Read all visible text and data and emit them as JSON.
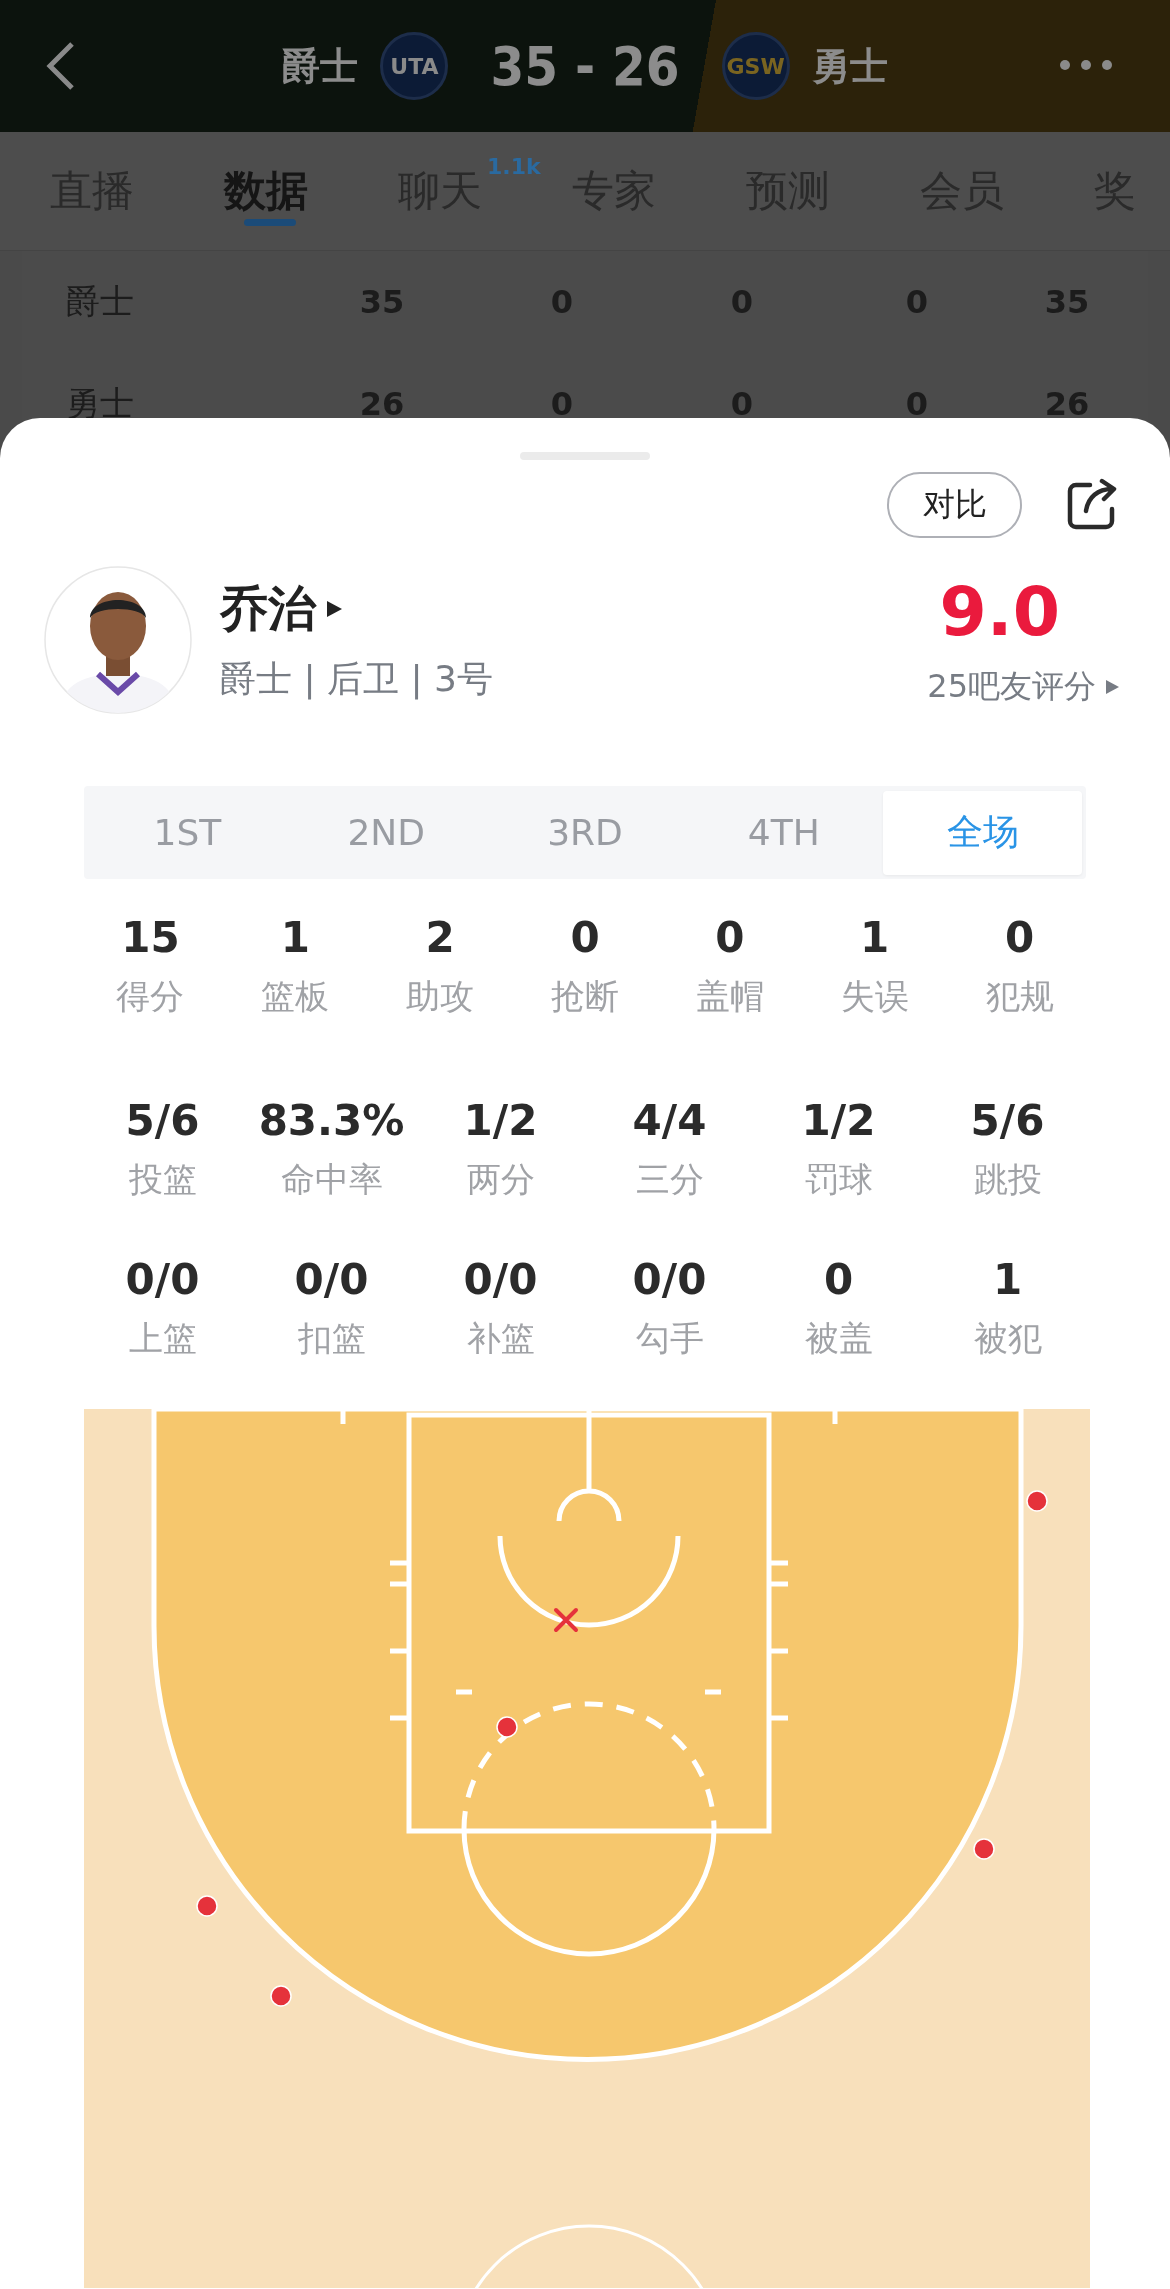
{
  "header": {
    "home": {
      "name": "爵士",
      "logo": "UTA"
    },
    "score": "35 - 26",
    "away": {
      "name": "勇士",
      "logo": "GSW"
    }
  },
  "tabs": [
    {
      "label": "直播",
      "selected": false
    },
    {
      "label": "数据",
      "selected": true
    },
    {
      "label": "聊天",
      "badge": "1.1k",
      "selected": false
    },
    {
      "label": "专家",
      "selected": false
    },
    {
      "label": "预测",
      "selected": false
    },
    {
      "label": "会员",
      "selected": false
    },
    {
      "label": "奖",
      "selected": false
    }
  ],
  "score_table": {
    "rows": [
      {
        "team": "爵士",
        "cells": [
          "35",
          "0",
          "0",
          "0",
          "35"
        ]
      },
      {
        "team": "勇士",
        "cells": [
          "26",
          "0",
          "0",
          "0",
          "26"
        ]
      }
    ]
  },
  "player_card": {
    "compare_button": "对比",
    "name": "乔治",
    "subtitle": "爵士 | 后卫 | 3号",
    "rating": "9.0",
    "rating_label": "25吧友评分",
    "periods": [
      {
        "label": "1ST",
        "selected": false
      },
      {
        "label": "2ND",
        "selected": false
      },
      {
        "label": "3RD",
        "selected": false
      },
      {
        "label": "4TH",
        "selected": false
      },
      {
        "label": "全场",
        "selected": true
      }
    ],
    "stat_rows": [
      [
        {
          "value": "15",
          "label": "得分"
        },
        {
          "value": "1",
          "label": "篮板"
        },
        {
          "value": "2",
          "label": "助攻"
        },
        {
          "value": "0",
          "label": "抢断"
        },
        {
          "value": "0",
          "label": "盖帽"
        },
        {
          "value": "1",
          "label": "失误"
        },
        {
          "value": "0",
          "label": "犯规"
        }
      ],
      [
        {
          "value": "5/6",
          "label": "投篮"
        },
        {
          "value": "83.3%",
          "label": "命中率"
        },
        {
          "value": "1/2",
          "label": "两分"
        },
        {
          "value": "4/4",
          "label": "三分"
        },
        {
          "value": "1/2",
          "label": "罚球"
        },
        {
          "value": "5/6",
          "label": "跳投"
        }
      ],
      [
        {
          "value": "0/0",
          "label": "上篮"
        },
        {
          "value": "0/0",
          "label": "扣篮"
        },
        {
          "value": "0/0",
          "label": "补篮"
        },
        {
          "value": "0/0",
          "label": "勾手"
        },
        {
          "value": "0",
          "label": "被盖"
        },
        {
          "value": "1",
          "label": "被犯"
        }
      ]
    ],
    "shots": [
      {
        "made": true
      },
      {
        "made": false
      },
      {
        "made": true
      },
      {
        "made": true
      },
      {
        "made": true
      },
      {
        "made": true
      }
    ]
  }
}
